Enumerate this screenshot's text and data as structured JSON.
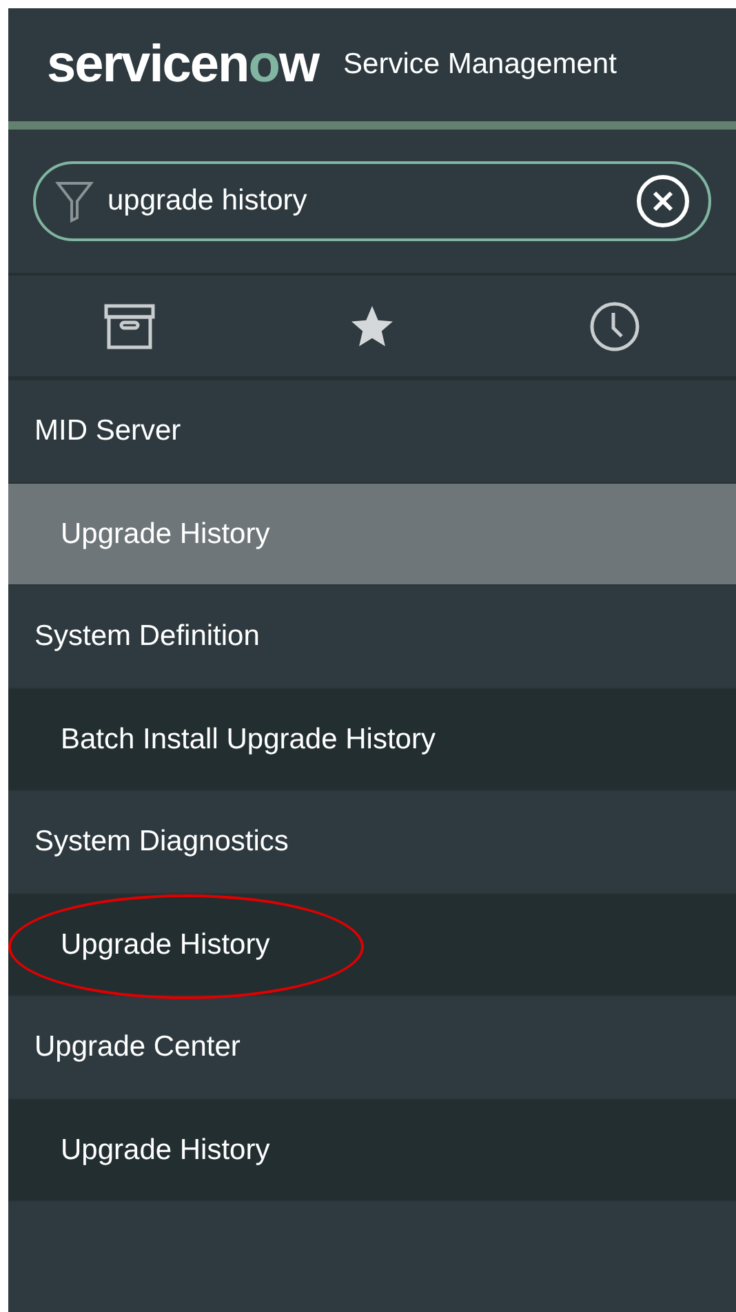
{
  "header": {
    "logo": [
      {
        "text": "servicen",
        "accent": false
      },
      {
        "text": "o",
        "accent": true
      },
      {
        "text": "w",
        "accent": false
      }
    ],
    "title": "Service Management"
  },
  "search": {
    "value": "upgrade history"
  },
  "nav_tabs": [
    {
      "kind": "archive",
      "selected": false
    },
    {
      "kind": "star",
      "selected": false
    },
    {
      "kind": "history",
      "selected": false
    }
  ],
  "sections": [
    {
      "label": "MID Server",
      "children": [
        {
          "label": "Upgrade History",
          "selected": true,
          "circled": false
        }
      ]
    },
    {
      "label": "System Definition",
      "children": [
        {
          "label": "Batch Install Upgrade History",
          "selected": false,
          "circled": false
        }
      ]
    },
    {
      "label": "System Diagnostics",
      "children": [
        {
          "label": "Upgrade History",
          "selected": false,
          "circled": true
        }
      ]
    },
    {
      "label": "Upgrade Center",
      "children": [
        {
          "label": "Upgrade History",
          "selected": false,
          "circled": false
        }
      ]
    }
  ]
}
